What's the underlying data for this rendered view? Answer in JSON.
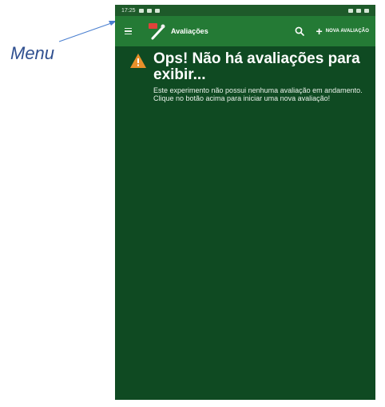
{
  "annotation": {
    "menu_label": "Menu"
  },
  "status_bar": {
    "time": "17:25"
  },
  "app_bar": {
    "title": "Avaliações",
    "new_button_label": "NOVA AVALIAÇÃO"
  },
  "empty_state": {
    "title": "Ops! Não há avaliações para exibir...",
    "description": "Este experimento não possui nenhuma avaliação em andamento. Clique no botão acima para iniciar uma nova avaliação!"
  },
  "colors": {
    "background": "#0f4a22",
    "app_bar": "#247a35",
    "warning": "#e8902a",
    "annotation": "#2f4f8f"
  },
  "icons": [
    "menu-icon",
    "app-logo-icon",
    "search-icon",
    "plus-icon",
    "warning-icon"
  ]
}
